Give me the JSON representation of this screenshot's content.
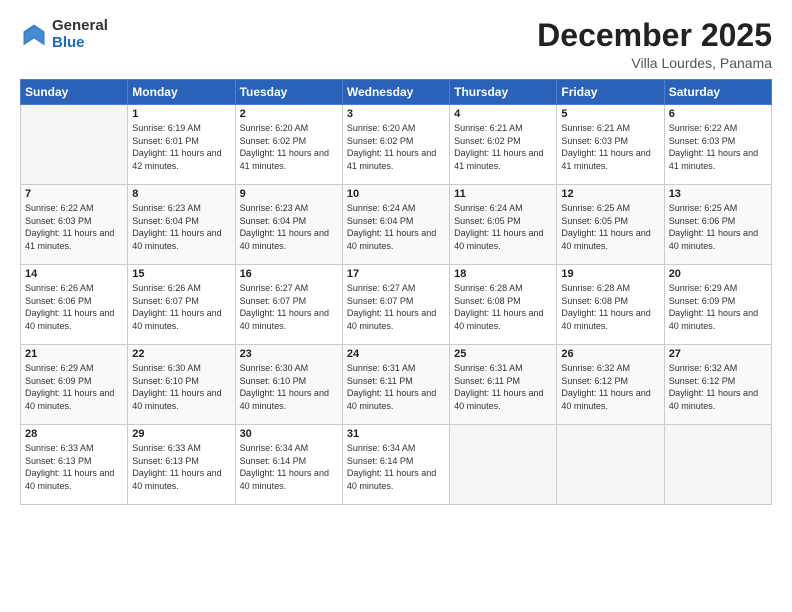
{
  "logo": {
    "general": "General",
    "blue": "Blue"
  },
  "header": {
    "month": "December 2025",
    "location": "Villa Lourdes, Panama"
  },
  "weekdays": [
    "Sunday",
    "Monday",
    "Tuesday",
    "Wednesday",
    "Thursday",
    "Friday",
    "Saturday"
  ],
  "weeks": [
    [
      {
        "day": "",
        "sunrise": "",
        "sunset": "",
        "daylight": ""
      },
      {
        "day": "1",
        "sunrise": "Sunrise: 6:19 AM",
        "sunset": "Sunset: 6:01 PM",
        "daylight": "Daylight: 11 hours and 42 minutes."
      },
      {
        "day": "2",
        "sunrise": "Sunrise: 6:20 AM",
        "sunset": "Sunset: 6:02 PM",
        "daylight": "Daylight: 11 hours and 41 minutes."
      },
      {
        "day": "3",
        "sunrise": "Sunrise: 6:20 AM",
        "sunset": "Sunset: 6:02 PM",
        "daylight": "Daylight: 11 hours and 41 minutes."
      },
      {
        "day": "4",
        "sunrise": "Sunrise: 6:21 AM",
        "sunset": "Sunset: 6:02 PM",
        "daylight": "Daylight: 11 hours and 41 minutes."
      },
      {
        "day": "5",
        "sunrise": "Sunrise: 6:21 AM",
        "sunset": "Sunset: 6:03 PM",
        "daylight": "Daylight: 11 hours and 41 minutes."
      },
      {
        "day": "6",
        "sunrise": "Sunrise: 6:22 AM",
        "sunset": "Sunset: 6:03 PM",
        "daylight": "Daylight: 11 hours and 41 minutes."
      }
    ],
    [
      {
        "day": "7",
        "sunrise": "Sunrise: 6:22 AM",
        "sunset": "Sunset: 6:03 PM",
        "daylight": "Daylight: 11 hours and 41 minutes."
      },
      {
        "day": "8",
        "sunrise": "Sunrise: 6:23 AM",
        "sunset": "Sunset: 6:04 PM",
        "daylight": "Daylight: 11 hours and 40 minutes."
      },
      {
        "day": "9",
        "sunrise": "Sunrise: 6:23 AM",
        "sunset": "Sunset: 6:04 PM",
        "daylight": "Daylight: 11 hours and 40 minutes."
      },
      {
        "day": "10",
        "sunrise": "Sunrise: 6:24 AM",
        "sunset": "Sunset: 6:04 PM",
        "daylight": "Daylight: 11 hours and 40 minutes."
      },
      {
        "day": "11",
        "sunrise": "Sunrise: 6:24 AM",
        "sunset": "Sunset: 6:05 PM",
        "daylight": "Daylight: 11 hours and 40 minutes."
      },
      {
        "day": "12",
        "sunrise": "Sunrise: 6:25 AM",
        "sunset": "Sunset: 6:05 PM",
        "daylight": "Daylight: 11 hours and 40 minutes."
      },
      {
        "day": "13",
        "sunrise": "Sunrise: 6:25 AM",
        "sunset": "Sunset: 6:06 PM",
        "daylight": "Daylight: 11 hours and 40 minutes."
      }
    ],
    [
      {
        "day": "14",
        "sunrise": "Sunrise: 6:26 AM",
        "sunset": "Sunset: 6:06 PM",
        "daylight": "Daylight: 11 hours and 40 minutes."
      },
      {
        "day": "15",
        "sunrise": "Sunrise: 6:26 AM",
        "sunset": "Sunset: 6:07 PM",
        "daylight": "Daylight: 11 hours and 40 minutes."
      },
      {
        "day": "16",
        "sunrise": "Sunrise: 6:27 AM",
        "sunset": "Sunset: 6:07 PM",
        "daylight": "Daylight: 11 hours and 40 minutes."
      },
      {
        "day": "17",
        "sunrise": "Sunrise: 6:27 AM",
        "sunset": "Sunset: 6:07 PM",
        "daylight": "Daylight: 11 hours and 40 minutes."
      },
      {
        "day": "18",
        "sunrise": "Sunrise: 6:28 AM",
        "sunset": "Sunset: 6:08 PM",
        "daylight": "Daylight: 11 hours and 40 minutes."
      },
      {
        "day": "19",
        "sunrise": "Sunrise: 6:28 AM",
        "sunset": "Sunset: 6:08 PM",
        "daylight": "Daylight: 11 hours and 40 minutes."
      },
      {
        "day": "20",
        "sunrise": "Sunrise: 6:29 AM",
        "sunset": "Sunset: 6:09 PM",
        "daylight": "Daylight: 11 hours and 40 minutes."
      }
    ],
    [
      {
        "day": "21",
        "sunrise": "Sunrise: 6:29 AM",
        "sunset": "Sunset: 6:09 PM",
        "daylight": "Daylight: 11 hours and 40 minutes."
      },
      {
        "day": "22",
        "sunrise": "Sunrise: 6:30 AM",
        "sunset": "Sunset: 6:10 PM",
        "daylight": "Daylight: 11 hours and 40 minutes."
      },
      {
        "day": "23",
        "sunrise": "Sunrise: 6:30 AM",
        "sunset": "Sunset: 6:10 PM",
        "daylight": "Daylight: 11 hours and 40 minutes."
      },
      {
        "day": "24",
        "sunrise": "Sunrise: 6:31 AM",
        "sunset": "Sunset: 6:11 PM",
        "daylight": "Daylight: 11 hours and 40 minutes."
      },
      {
        "day": "25",
        "sunrise": "Sunrise: 6:31 AM",
        "sunset": "Sunset: 6:11 PM",
        "daylight": "Daylight: 11 hours and 40 minutes."
      },
      {
        "day": "26",
        "sunrise": "Sunrise: 6:32 AM",
        "sunset": "Sunset: 6:12 PM",
        "daylight": "Daylight: 11 hours and 40 minutes."
      },
      {
        "day": "27",
        "sunrise": "Sunrise: 6:32 AM",
        "sunset": "Sunset: 6:12 PM",
        "daylight": "Daylight: 11 hours and 40 minutes."
      }
    ],
    [
      {
        "day": "28",
        "sunrise": "Sunrise: 6:33 AM",
        "sunset": "Sunset: 6:13 PM",
        "daylight": "Daylight: 11 hours and 40 minutes."
      },
      {
        "day": "29",
        "sunrise": "Sunrise: 6:33 AM",
        "sunset": "Sunset: 6:13 PM",
        "daylight": "Daylight: 11 hours and 40 minutes."
      },
      {
        "day": "30",
        "sunrise": "Sunrise: 6:34 AM",
        "sunset": "Sunset: 6:14 PM",
        "daylight": "Daylight: 11 hours and 40 minutes."
      },
      {
        "day": "31",
        "sunrise": "Sunrise: 6:34 AM",
        "sunset": "Sunset: 6:14 PM",
        "daylight": "Daylight: 11 hours and 40 minutes."
      },
      {
        "day": "",
        "sunrise": "",
        "sunset": "",
        "daylight": ""
      },
      {
        "day": "",
        "sunrise": "",
        "sunset": "",
        "daylight": ""
      },
      {
        "day": "",
        "sunrise": "",
        "sunset": "",
        "daylight": ""
      }
    ]
  ]
}
